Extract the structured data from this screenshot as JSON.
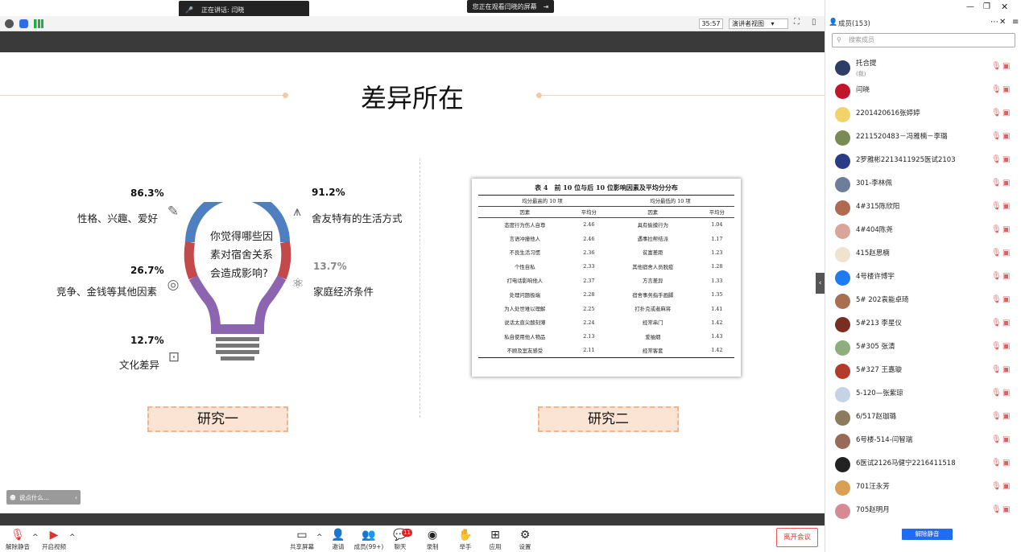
{
  "top": {
    "speaking_label": "正在讲话: 闫晓",
    "watching_label": "您正在观看闫晓的屏幕",
    "timer": "35:57",
    "view_mode": "演讲者视图"
  },
  "slide": {
    "title": "差异所在",
    "bulb_question": "你觉得哪些因素对宿舍关系会造成影响?",
    "factors": [
      {
        "pct": "86.3%",
        "label": "性格、兴趣、爱好",
        "icon": "pencil-icon"
      },
      {
        "pct": "26.7%",
        "label": "竞争、金钱等其他因素",
        "icon": "target-icon"
      },
      {
        "pct": "12.7%",
        "label": "文化差异",
        "icon": "toolbox-icon"
      },
      {
        "pct": "91.2%",
        "label": "舍友特有的生活方式",
        "icon": "compass-icon"
      },
      {
        "pct": "13.7%",
        "label": "家庭经济条件",
        "icon": "atom-icon"
      }
    ],
    "study1": "研究一",
    "study2": "研究二",
    "table": {
      "title": "表 4　前 10 位与后 10 位影响因素及平均分分布",
      "group_high": "均分最高的 10 项",
      "group_low": "均分最低的 10 项",
      "col_factor": "因素",
      "col_avg": "平均分",
      "rows": [
        [
          "态度行为伤人自尊",
          "2.46",
          "具有偷摸行为",
          "1.04"
        ],
        [
          "言语冲撞他人",
          "2.46",
          "遇事拉帮结派",
          "1.17"
        ],
        [
          "不良生活习惯",
          "2.36",
          "贫富差距",
          "1.23"
        ],
        [
          "个性自私",
          "2.33",
          "其他宿舍人员脱疫",
          "1.28"
        ],
        [
          "打电话影响他人",
          "2.37",
          "方言差异",
          "1.33"
        ],
        [
          "处理问题极端",
          "2.28",
          "宿舍事务指手画脚",
          "1.35"
        ],
        [
          "为人处世难以理解",
          "2.25",
          "打扑克或者麻将",
          "1.41"
        ],
        [
          "说话太直尖酸刻薄",
          "2.24",
          "经常串门",
          "1.42"
        ],
        [
          "私自使用他人物品",
          "2.13",
          "爱抽烟",
          "1.43"
        ],
        [
          "不顾及室友感受",
          "2.11",
          "经常客套",
          "1.42"
        ]
      ]
    },
    "danmu_placeholder": "说点什么..."
  },
  "bottom": {
    "unmute": "解除静音",
    "video": "开启视频",
    "share": "共享屏幕",
    "invite": "邀请",
    "members": "成员(99+)",
    "chat": "聊天",
    "chat_badge": "11",
    "record": "录制",
    "raise": "举手",
    "apps": "应用",
    "settings": "设置",
    "leave": "离开会议"
  },
  "panel": {
    "title": "成员(153)",
    "search_placeholder": "搜索成员",
    "unmute_all": "解除静音",
    "members": [
      {
        "name": "托合提",
        "sub": "(我)",
        "color": "#2d3e66"
      },
      {
        "name": "闫晓",
        "sub": "",
        "color": "#c2142a"
      },
      {
        "name": "2201420616张婷婷",
        "sub": "",
        "color": "#f2d26a"
      },
      {
        "name": "2211520483－冯雅楠－李璐",
        "sub": "",
        "color": "#7a8a55"
      },
      {
        "name": "2罗雅彬2213411925医试2103",
        "sub": "",
        "color": "#2a3c88"
      },
      {
        "name": "301-李林佩",
        "sub": "",
        "color": "#6d7d9a"
      },
      {
        "name": "4#315陈欣阳",
        "sub": "",
        "color": "#b06a50"
      },
      {
        "name": "4#404陈尧",
        "sub": "",
        "color": "#d9a59b"
      },
      {
        "name": "415赵思楠",
        "sub": "",
        "color": "#efe2cf"
      },
      {
        "name": "4号楼许博宇",
        "sub": "",
        "color": "#1e7cf0"
      },
      {
        "name": "5# 202袁能卓琦",
        "sub": "",
        "color": "#a87050"
      },
      {
        "name": "5#213 李星仪",
        "sub": "",
        "color": "#7a2e22"
      },
      {
        "name": "5#305 张清",
        "sub": "",
        "color": "#8fae7f"
      },
      {
        "name": "5#327 王嘉璇",
        "sub": "",
        "color": "#b33b2a"
      },
      {
        "name": "5-120—张紫琼",
        "sub": "",
        "color": "#c6d3e6"
      },
      {
        "name": "6/517赵珈璐",
        "sub": "",
        "color": "#8a7c5c"
      },
      {
        "name": "6号楼-514-闫智瑞",
        "sub": "",
        "color": "#986b58"
      },
      {
        "name": "6医试2126马健宁2216411518",
        "sub": "",
        "color": "#222222"
      },
      {
        "name": "701汪永芳",
        "sub": "",
        "color": "#d99f55"
      },
      {
        "name": "705赵明月",
        "sub": "",
        "color": "#d78a95"
      }
    ]
  }
}
